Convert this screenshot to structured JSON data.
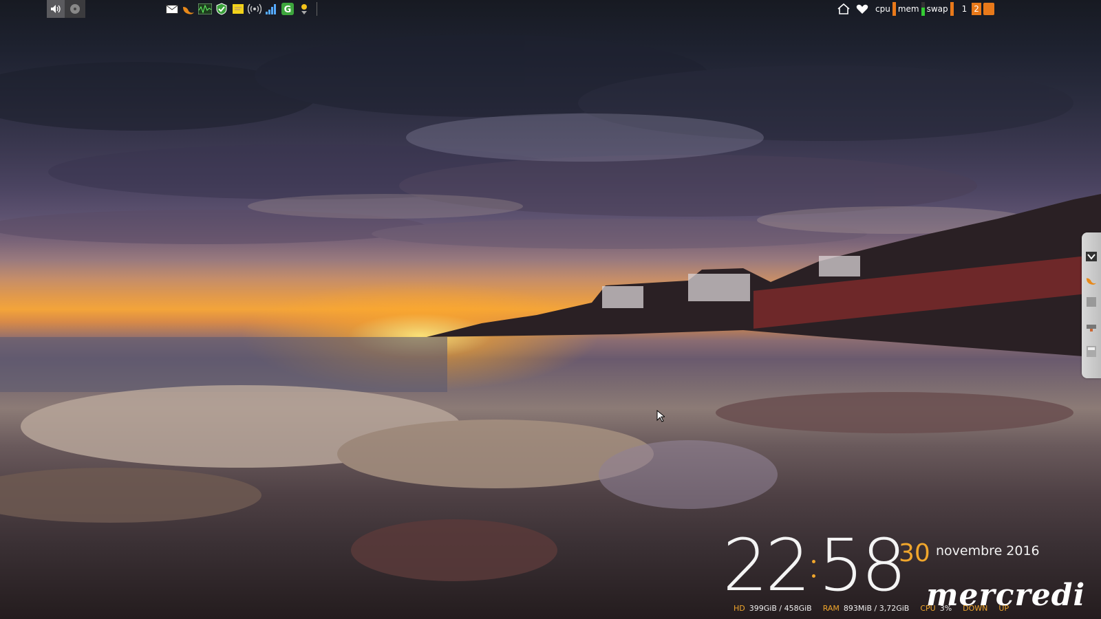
{
  "topbar": {
    "left_buttons": [
      {
        "icon": "speaker-icon"
      },
      {
        "icon": "disk-icon"
      }
    ],
    "tray_icons": [
      "mail-icon",
      "flame-icon",
      "system-monitor-icon",
      "shield-check-icon",
      "sticky-note-icon",
      "wireless-signal-icon",
      "signal-bars-icon",
      "g-app-icon",
      "weather-icon"
    ],
    "right": {
      "cpu_label": "cpu",
      "mem_label": "mem",
      "swap_label": "swap",
      "workspaces": [
        "1",
        "2"
      ],
      "active_workspace": "2"
    }
  },
  "clock": {
    "hours": "22",
    "minutes": "58",
    "day": "30",
    "month_year": "novembre 2016",
    "weekday": "mercredi"
  },
  "stats": {
    "hd_label": "HD",
    "hd_value": "399GiB  / 458GiB",
    "ram_label": "RAM",
    "ram_value": "893MiB  / 3,72GiB",
    "cpu_label": "CPU",
    "cpu_value": "3%",
    "down_label": "DOWN",
    "up_label": "UP"
  },
  "colors": {
    "accent": "#e8791a",
    "clock_accent": "#f0a62c"
  }
}
